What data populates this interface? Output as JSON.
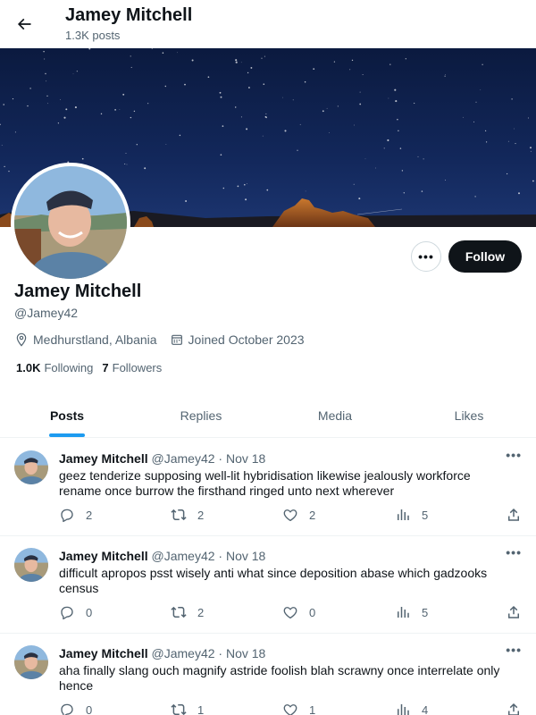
{
  "header": {
    "name": "Jamey Mitchell",
    "posts_count": "1.3K posts"
  },
  "profile": {
    "name": "Jamey Mitchell",
    "handle": "@Jamey42",
    "location": "Medhurstland, Albania",
    "joined": "Joined October 2023",
    "following_count": "1.0K",
    "following_label": "Following",
    "followers_count": "7",
    "followers_label": "Followers",
    "more_label": "•••",
    "follow_label": "Follow"
  },
  "tabs": [
    {
      "label": "Posts",
      "active": true
    },
    {
      "label": "Replies",
      "active": false
    },
    {
      "label": "Media",
      "active": false
    },
    {
      "label": "Likes",
      "active": false
    }
  ],
  "posts": [
    {
      "name": "Jamey Mitchell",
      "handle": "@Jamey42",
      "sep": "·",
      "date": "Nov 18",
      "text": "geez tenderize supposing well-lit hybridisation likewise jealously workforce rename once burrow the firsthand ringed unto next wherever",
      "replies": "2",
      "reposts": "2",
      "likes": "2",
      "views": "5"
    },
    {
      "name": "Jamey Mitchell",
      "handle": "@Jamey42",
      "sep": "·",
      "date": "Nov 18",
      "text": "difficult apropos psst wisely anti what since deposition abase which gadzooks census",
      "replies": "0",
      "reposts": "2",
      "likes": "0",
      "views": "5"
    },
    {
      "name": "Jamey Mitchell",
      "handle": "@Jamey42",
      "sep": "·",
      "date": "Nov 18",
      "text": "aha finally slang ouch magnify astride foolish blah scrawny once interrelate only hence",
      "replies": "0",
      "reposts": "1",
      "likes": "1",
      "views": "4"
    }
  ],
  "icons": {
    "back": "arrow-left-icon",
    "location": "location-pin-icon",
    "calendar": "calendar-icon",
    "reply": "reply-icon",
    "repost": "repost-icon",
    "like": "heart-icon",
    "views": "views-icon",
    "share": "share-icon",
    "more": "more-icon"
  },
  "colors": {
    "accent": "#1d9bf0",
    "text": "#0f1419",
    "muted": "#536471",
    "follow_bg": "#0f1419"
  }
}
